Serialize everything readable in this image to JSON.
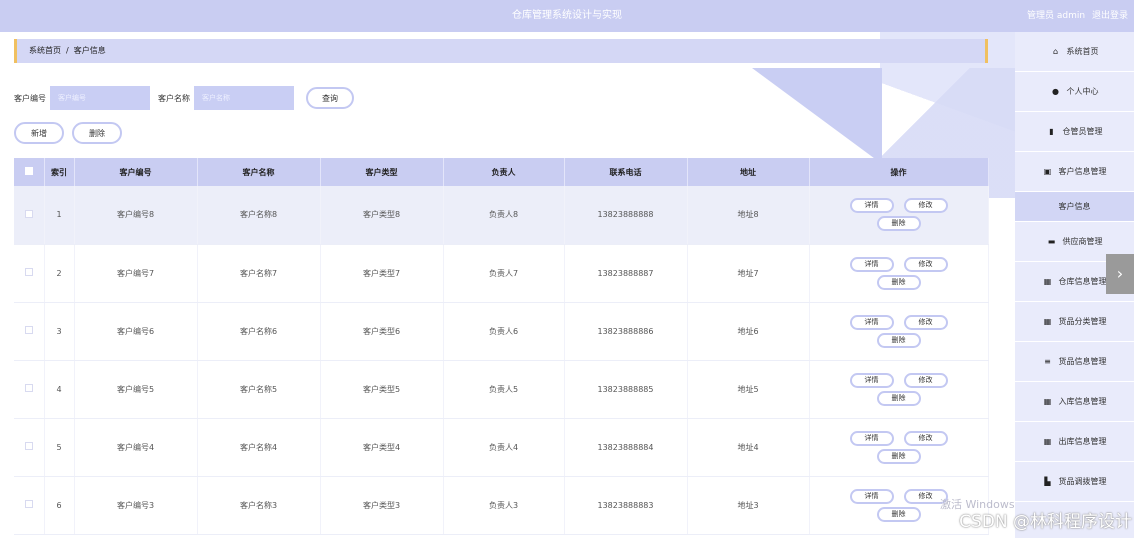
{
  "header": {
    "title": "仓库管理系统设计与实现",
    "user_role": "管理员 admin",
    "logout": "退出登录"
  },
  "breadcrumb": {
    "home": "系统首页",
    "separator": "/",
    "current": "客户信息"
  },
  "search": {
    "customer_no_label": "客户编号",
    "customer_no_placeholder": "客户编号",
    "customer_name_label": "客户名称",
    "customer_name_placeholder": "客户名称",
    "query_button": "查询"
  },
  "actions": {
    "add": "新增",
    "delete": "删除"
  },
  "table": {
    "headers": [
      "索引",
      "客户编号",
      "客户名称",
      "客户类型",
      "负责人",
      "联系电话",
      "地址",
      "操作"
    ],
    "rows": [
      {
        "index": "1",
        "no": "客户编号8",
        "name": "客户名称8",
        "type": "客户类型8",
        "owner": "负责人8",
        "phone": "13823888888",
        "addr": "地址8"
      },
      {
        "index": "2",
        "no": "客户编号7",
        "name": "客户名称7",
        "type": "客户类型7",
        "owner": "负责人7",
        "phone": "13823888887",
        "addr": "地址7"
      },
      {
        "index": "3",
        "no": "客户编号6",
        "name": "客户名称6",
        "type": "客户类型6",
        "owner": "负责人6",
        "phone": "13823888886",
        "addr": "地址6"
      },
      {
        "index": "4",
        "no": "客户编号5",
        "name": "客户名称5",
        "type": "客户类型5",
        "owner": "负责人5",
        "phone": "13823888885",
        "addr": "地址5"
      },
      {
        "index": "5",
        "no": "客户编号4",
        "name": "客户名称4",
        "type": "客户类型4",
        "owner": "负责人4",
        "phone": "13823888884",
        "addr": "地址4"
      },
      {
        "index": "6",
        "no": "客户编号3",
        "name": "客户名称3",
        "type": "客户类型3",
        "owner": "负责人3",
        "phone": "13823888883",
        "addr": "地址3"
      }
    ],
    "op_detail": "详情",
    "op_edit": "修改",
    "op_delete": "删除"
  },
  "sidebar": {
    "items": [
      {
        "label": "系统首页",
        "icon": "home-icon",
        "glyph": "⌂"
      },
      {
        "label": "个人中心",
        "icon": "user-icon",
        "glyph": "●"
      },
      {
        "label": "仓管员管理",
        "icon": "bar-chart-icon",
        "glyph": "▮"
      },
      {
        "label": "客户信息管理",
        "icon": "clipboard-icon",
        "glyph": "▣"
      },
      {
        "label": "客户信息",
        "icon": "",
        "glyph": ""
      },
      {
        "label": "供应商管理",
        "icon": "monitor-icon",
        "glyph": "▬"
      },
      {
        "label": "仓库信息管理",
        "icon": "grid-icon",
        "glyph": "▦"
      },
      {
        "label": "货品分类管理",
        "icon": "grid-icon",
        "glyph": "▦"
      },
      {
        "label": "货品信息管理",
        "icon": "sliders-icon",
        "glyph": "≡"
      },
      {
        "label": "入库信息管理",
        "icon": "grid-icon",
        "glyph": "▦"
      },
      {
        "label": "出库信息管理",
        "icon": "grid-icon",
        "glyph": "▦"
      },
      {
        "label": "货品调拨管理",
        "icon": "chart-icon",
        "glyph": "▙"
      }
    ]
  },
  "overlay": {
    "windows_watermark": "激活 Windows",
    "csdn_watermark": "CSDN @林科程序设计"
  },
  "colors": {
    "accent": "#c9cdf2",
    "border_accent": "#f0c060"
  }
}
